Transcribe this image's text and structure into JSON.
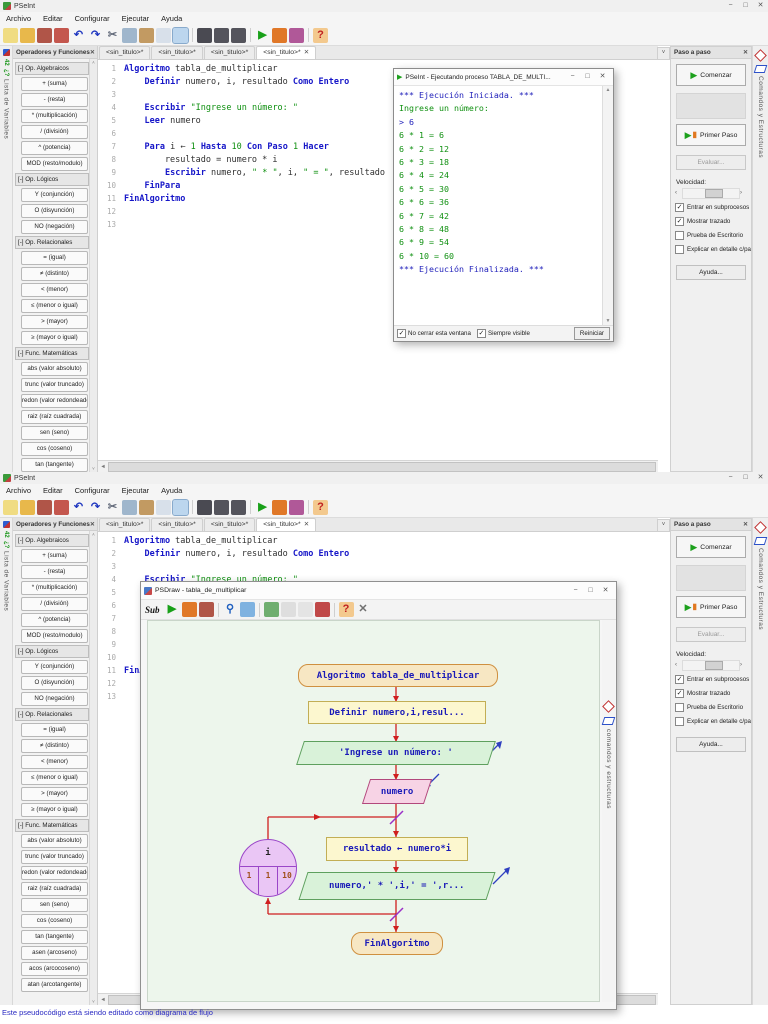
{
  "app": {
    "title": "PSeInt",
    "menus": [
      "Archivo",
      "Editar",
      "Configurar",
      "Ejecutar",
      "Ayuda"
    ],
    "tabs": {
      "labels": [
        "<sin_titulo>*",
        "<sin_titulo>*",
        "<sin_titulo>*",
        "<sin_titulo>*"
      ],
      "active": 3
    },
    "toolbar": [
      {
        "name": "new-file-icon",
        "bg": "#f0dc82"
      },
      {
        "name": "open-file-icon",
        "bg": "#e8b84b"
      },
      {
        "name": "save-icon",
        "bg": "#b05548"
      },
      {
        "name": "save-all-icon",
        "bg": "#c4574e"
      },
      {
        "name": "undo-icon",
        "glyph": "↶",
        "fg": "#2038c0"
      },
      {
        "name": "redo-icon",
        "glyph": "↷",
        "fg": "#2038c0"
      },
      {
        "name": "cut-icon",
        "glyph": "✂",
        "fg": "#606878"
      },
      {
        "name": "copy-icon",
        "bg": "#9fb6cc"
      },
      {
        "name": "paste-icon",
        "bg": "#c29a62"
      },
      {
        "name": "format-icon",
        "bg": "#d8e0ea"
      },
      {
        "name": "step-view-icon",
        "bg": "#bcd6ee",
        "pressed": true
      },
      {
        "sep": true
      },
      {
        "name": "find-icon",
        "bg": "#4a4a52"
      },
      {
        "name": "find-prev-icon",
        "bg": "#54545c"
      },
      {
        "name": "find-next-icon",
        "bg": "#54545c"
      },
      {
        "sep": true
      },
      {
        "name": "run-icon",
        "glyph": "▶",
        "fg": "#18a018"
      },
      {
        "name": "step-run-icon",
        "bg": "#e07828"
      },
      {
        "name": "flowchart-icon",
        "bg": "#b05898"
      },
      {
        "sep": true
      },
      {
        "name": "help-icon",
        "glyph": "?",
        "fg": "#c02020",
        "bg": "#f3c98e"
      }
    ]
  },
  "glyphs": {
    "min": "−",
    "max": "□",
    "close": "✕",
    "up": "▲",
    "down": "▼",
    "left": "◄",
    "chev_left": "‹",
    "chev_right": "›",
    "overflow": "˅",
    "scroll_up": "˄",
    "scroll_down": "˅",
    "check": "✓",
    "play": "▶",
    "playbar": "▮"
  },
  "left_strip": {
    "badge": "42",
    "help_badge": "¿?",
    "label": "Lista de Variables"
  },
  "right_strip": {
    "label": "Comandos y Estructuras"
  },
  "ops": {
    "title": "Operadores y Funciones",
    "sections": [
      {
        "header": "[-] Op. Algebraicos",
        "items": [
          "+ (suma)",
          "- (resta)",
          "* (multiplicación)",
          "/ (división)",
          "^ (potencia)",
          "MOD (resto/modulo)"
        ]
      },
      {
        "header": "[-] Op. Lógicos",
        "items": [
          "Y (conjunción)",
          "O (disyunción)",
          "NO (negación)"
        ]
      },
      {
        "header": "[-] Op. Relacionales",
        "items": [
          "= (igual)",
          "≠ (distinto)",
          "< (menor)",
          "≤ (menor o igual)",
          "> (mayor)",
          "≥ (mayor o igual)"
        ]
      },
      {
        "header": "[-] Func. Matemáticas",
        "items": [
          "abs (valor absoluto)",
          "trunc (valor truncado)",
          "redon (valor redondeado)",
          "raiz (raíz cuadrada)",
          "sen (seno)",
          "cos (coseno)",
          "tan (tangente)",
          "asen (arcoseno)",
          "acos (arcocoseno)",
          "atan (arcotangente)"
        ]
      }
    ]
  },
  "editor": {
    "lines": [
      [
        [
          "k",
          "Algoritmo"
        ],
        [
          "p",
          " tabla_de_multiplicar"
        ]
      ],
      [
        [
          "p",
          "    "
        ],
        [
          "k",
          "Definir"
        ],
        [
          "p",
          " numero, i, resultado "
        ],
        [
          "k",
          "Como"
        ],
        [
          "p",
          " "
        ],
        [
          "k",
          "Entero"
        ]
      ],
      [],
      [
        [
          "p",
          "    "
        ],
        [
          "k",
          "Escribir"
        ],
        [
          "p",
          " "
        ],
        [
          "s",
          "\"Ingrese un número: \""
        ]
      ],
      [
        [
          "p",
          "    "
        ],
        [
          "k",
          "Leer"
        ],
        [
          "p",
          " numero"
        ]
      ],
      [],
      [
        [
          "p",
          "    "
        ],
        [
          "k",
          "Para"
        ],
        [
          "p",
          " i ← "
        ],
        [
          "n",
          "1"
        ],
        [
          "p",
          " "
        ],
        [
          "k",
          "Hasta"
        ],
        [
          "p",
          " "
        ],
        [
          "n",
          "10"
        ],
        [
          "p",
          " "
        ],
        [
          "k",
          "Con Paso"
        ],
        [
          "p",
          " "
        ],
        [
          "n",
          "1"
        ],
        [
          "p",
          " "
        ],
        [
          "k",
          "Hacer"
        ]
      ],
      [
        [
          "p",
          "        resultado = numero * i"
        ]
      ],
      [
        [
          "p",
          "        "
        ],
        [
          "k",
          "Escribir"
        ],
        [
          "p",
          " numero, "
        ],
        [
          "s",
          "\" * \""
        ],
        [
          "p",
          ", i, "
        ],
        [
          "s",
          "\" = \""
        ],
        [
          "p",
          ", resultado"
        ]
      ],
      [
        [
          "p",
          "    "
        ],
        [
          "k",
          "FinPara"
        ]
      ],
      [
        [
          "k",
          "FinAlgoritmo"
        ]
      ],
      [],
      []
    ]
  },
  "exec": {
    "title": "PSeInt - Ejecutando proceso TABLA_DE_MULTI...",
    "lines": [
      {
        "t": "*** Ejecución Iniciada. ***",
        "c": "b"
      },
      {
        "t": "Ingrese un número:",
        "c": "g"
      },
      {
        "t": "> 6",
        "c": "b"
      },
      {
        "t": "6 * 1 = 6",
        "c": "g"
      },
      {
        "t": "6 * 2 = 12",
        "c": "g"
      },
      {
        "t": "6 * 3 = 18",
        "c": "g"
      },
      {
        "t": "6 * 4 = 24",
        "c": "g"
      },
      {
        "t": "6 * 5 = 30",
        "c": "g"
      },
      {
        "t": "6 * 6 = 36",
        "c": "g"
      },
      {
        "t": "6 * 7 = 42",
        "c": "g"
      },
      {
        "t": "6 * 8 = 48",
        "c": "g"
      },
      {
        "t": "6 * 9 = 54",
        "c": "g"
      },
      {
        "t": "6 * 10 = 60",
        "c": "g"
      },
      {
        "t": "*** Ejecución Finalizada. ***",
        "c": "b"
      }
    ],
    "footer": {
      "cb1": "No cerrar esta ventana",
      "cb2": "Siempre visible",
      "restart": "Reiniciar"
    }
  },
  "paso": {
    "title": "Paso a paso",
    "start": "Comenzar",
    "first": "Primer Paso",
    "eval": "Evaluar...",
    "speed_label": "Velocidad:",
    "checkboxes": [
      {
        "label": "Entrar en subprocesos",
        "checked": true
      },
      {
        "label": "Mostrar trazado",
        "checked": true
      },
      {
        "label": "Prueba de Escritorio",
        "checked": false
      },
      {
        "label": "Explicar en detalle c/paso",
        "checked": false
      }
    ],
    "help": "Ayuda..."
  },
  "psdraw": {
    "title": "PSDraw - tabla_de_multiplicar",
    "sub_label": "Sub",
    "toolbar": [
      {
        "name": "run-icon",
        "glyph": "▶",
        "fg": "#18a018"
      },
      {
        "name": "step-run-icon",
        "bg": "#e07828"
      },
      {
        "name": "save-icon",
        "bg": "#b05548"
      },
      {
        "sep": true
      },
      {
        "name": "zoom-icon",
        "glyph": "⚲",
        "fg": "#2060c0"
      },
      {
        "name": "fit-view-icon",
        "bg": "#7fb2e0"
      },
      {
        "sep": true
      },
      {
        "name": "edit-shapes-icon",
        "bg": "#6fae6f"
      },
      {
        "name": "grid-icon",
        "bg": "#b8b8b8",
        "disabled": true
      },
      {
        "name": "labels-icon",
        "bg": "#c8c8c8",
        "disabled": true
      },
      {
        "name": "draw-icon",
        "bg": "#c04848"
      },
      {
        "sep": true
      },
      {
        "name": "help-icon",
        "glyph": "?",
        "fg": "#c02020",
        "bg": "#f3c98e"
      },
      {
        "name": "close-icon",
        "glyph": "✕",
        "fg": "#707070"
      }
    ],
    "strip_label": "comandos y estructuras",
    "flowchart": {
      "start": "Algoritmo tabla_de_multiplicar",
      "define": "Definir numero,i,resul...",
      "output1": "'Ingrese un número: '",
      "input1": "numero",
      "loop": {
        "var": "i",
        "from": "1",
        "step": "1",
        "to": "10"
      },
      "assign": "resultado ← numero*i",
      "output2": "numero,' * ',i,' = ',r...",
      "end": "FinAlgoritmo"
    }
  },
  "statusbar": {
    "text": "Este pseudocódigo está siendo editado como diagrama de flujo"
  }
}
